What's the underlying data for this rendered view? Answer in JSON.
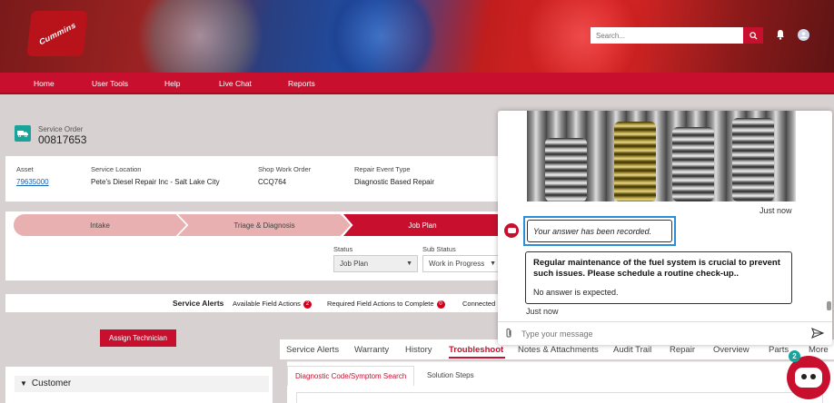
{
  "header": {
    "brand": "Cummins",
    "search": {
      "placeholder": "Search...",
      "value": ""
    }
  },
  "nav": {
    "items": [
      "Home",
      "User Tools",
      "Help",
      "Live Chat",
      "Reports"
    ]
  },
  "service_order": {
    "label": "Service Order",
    "number": "00817653"
  },
  "details": [
    {
      "label": "Asset",
      "value": "79635000"
    },
    {
      "label": "Service Location",
      "value": "Pete's Diesel Repair Inc - Salt Lake City"
    },
    {
      "label": "Shop Work Order",
      "value": "CCQ764"
    },
    {
      "label": "Repair Event Type",
      "value": "Diagnostic Based Repair"
    }
  ],
  "path": {
    "steps": [
      "Intake",
      "Triage & Diagnosis",
      "Job Plan"
    ],
    "active_step": "Job Plan",
    "status": {
      "label": "Status",
      "value": "Job Plan"
    },
    "sub_status": {
      "label": "Sub Status",
      "value": "Work in Progress"
    }
  },
  "alerts": {
    "title": "Service Alerts",
    "available_label": "Available Field Actions",
    "available_count": "2",
    "required_label": "Required Field Actions to Complete",
    "required_count": "0",
    "connected_label": "Connected"
  },
  "assign_button": "Assign Technician",
  "customer_section": "Customer",
  "tabs": {
    "items": [
      "Service Alerts",
      "Warranty",
      "History",
      "Troubleshoot",
      "Notes & Attachments",
      "Audit Trail",
      "Repair",
      "Overview",
      "Parts",
      "More"
    ],
    "active": "Troubleshoot"
  },
  "subtabs": {
    "items": [
      "Diagnostic Code/Symptom Search",
      "Solution Steps"
    ],
    "active": "Diagnostic Code/Symptom Search"
  },
  "chat": {
    "time_1": "Just now",
    "recorded_msg": "Your answer has been recorded.",
    "main_msg": "Regular maintenance of the fuel system is crucial to prevent such issues. Please schedule a routine check-up..",
    "note_msg": "No answer is expected.",
    "time_2": "Just now",
    "input_placeholder": "Type your message"
  },
  "bot_badge": "2",
  "colors": {
    "brand_red": "#c8102e",
    "teal": "#1aa39a",
    "link_blue": "#1563b5",
    "focus_blue": "#2a8fd8"
  }
}
